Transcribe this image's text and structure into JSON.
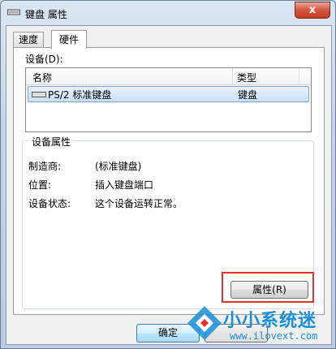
{
  "window": {
    "title": "键盘 属性",
    "close_glyph": "x"
  },
  "tabs": [
    {
      "label": "速度",
      "active": false
    },
    {
      "label": "硬件",
      "active": true
    }
  ],
  "devices": {
    "label": "设备(D):",
    "columns": [
      "名称",
      "类型"
    ],
    "rows": [
      {
        "name": "PS/2 标准键盘",
        "type": "键盘",
        "selected": true
      }
    ]
  },
  "device_properties": {
    "title": "设备属性",
    "fields": [
      {
        "label": "制造商:",
        "value": "(标准键盘)"
      },
      {
        "label": "位置:",
        "value": "插入键盘端口"
      },
      {
        "label": "设备状态:",
        "value": "这个设备运转正常。"
      }
    ],
    "properties_button": "属性(R)",
    "highlight_color": "#e8312b"
  },
  "footer": {
    "ok_label": "确定"
  },
  "watermark": {
    "brand": "小小系统迷",
    "url": "www.ilovext.com"
  },
  "colors": {
    "accent": "#3c7fb1",
    "selection": "#c9e0f7"
  }
}
